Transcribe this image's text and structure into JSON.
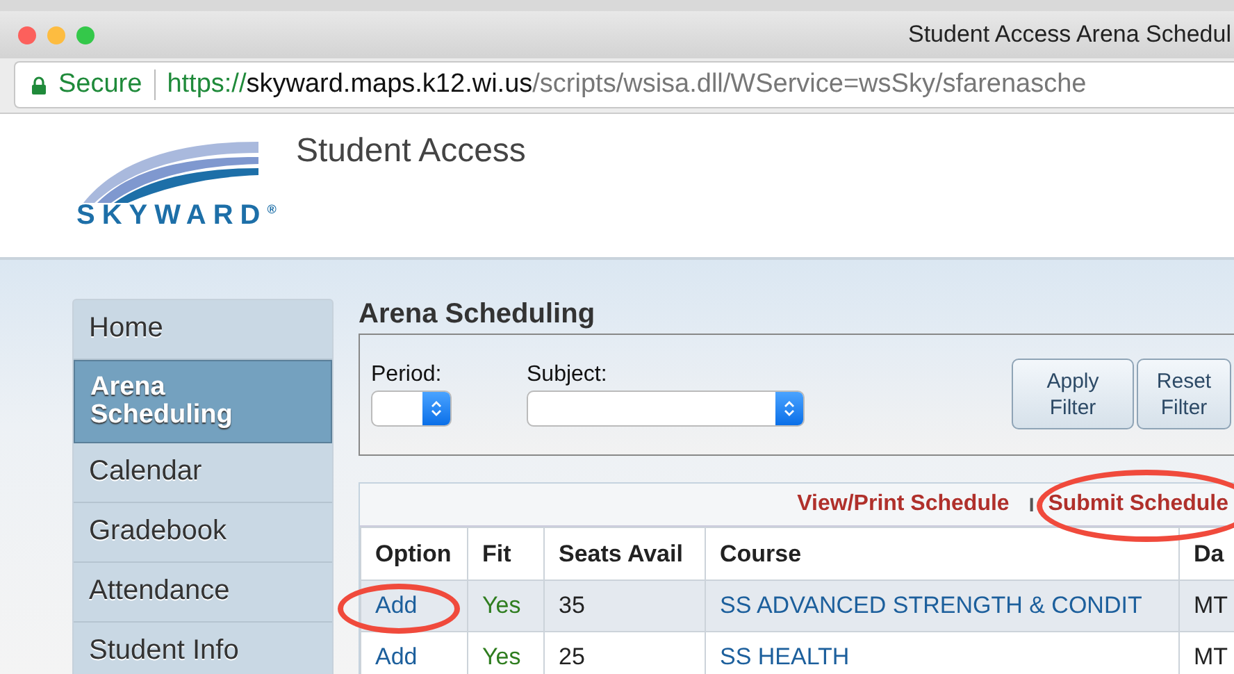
{
  "window": {
    "title": "Student Access Arena Schedul"
  },
  "address_bar": {
    "secure_label": "Secure",
    "scheme": "https://",
    "host": "skyward.maps.k12.wi.us",
    "path": "/scripts/wsisa.dll/WService=wsSky/sfarenasche"
  },
  "header": {
    "logo_text": "SKYWARD$^{®}$",
    "app_title": "Student Access"
  },
  "sidebar": {
    "items": [
      {
        "label": "Home",
        "selected": false
      },
      {
        "label": "Arena Scheduling",
        "selected": true
      },
      {
        "label": "Calendar",
        "selected": false
      },
      {
        "label": "Gradebook",
        "selected": false
      },
      {
        "label": "Attendance",
        "selected": false
      },
      {
        "label": "Student Info",
        "selected": false
      }
    ]
  },
  "page_title": "Arena Scheduling",
  "filters": {
    "period_label": "Period:",
    "subject_label": "Subject:",
    "buttons": [
      "Apply Filter",
      "Reset Filter"
    ]
  },
  "actions": [
    {
      "label": "View/Print Schedule",
      "highlighted": false
    },
    {
      "label": "Submit Schedule",
      "highlighted": true
    }
  ],
  "actions_separator": "I",
  "table": {
    "columns": [
      "Option",
      "Fit",
      "Seats Avail",
      "Course",
      "Da"
    ],
    "rows": [
      {
        "option": "Add",
        "fit": "Yes",
        "seats": "35",
        "course": "SS ADVANCED STRENGTH & CONDIT",
        "column_5": "MT",
        "selected": true,
        "highlighted": true
      },
      {
        "option": "Add",
        "fit": "Yes",
        "seats": "25",
        "course": "SS HEALTH",
        "column_5": "MT",
        "selected": false,
        "highlighted": false
      }
    ]
  }
}
